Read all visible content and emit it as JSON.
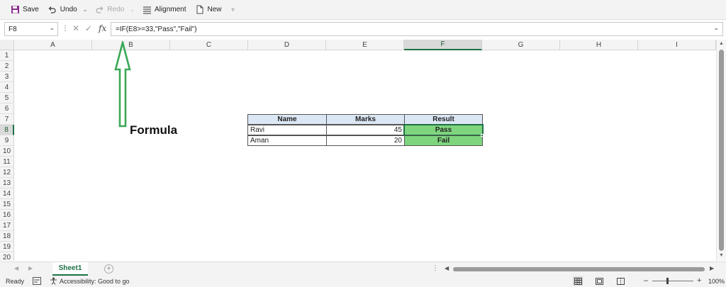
{
  "toolbar": {
    "save": "Save",
    "undo": "Undo",
    "redo": "Redo",
    "alignment": "Alignment",
    "new": "New"
  },
  "formula_bar": {
    "name_box": "F8",
    "formula": "=IF(E8>=33,\"Pass\",\"Fail\")"
  },
  "grid": {
    "columns": [
      "A",
      "B",
      "C",
      "D",
      "E",
      "F",
      "G",
      "H",
      "I"
    ],
    "rows": [
      "1",
      "2",
      "3",
      "4",
      "5",
      "6",
      "7",
      "8",
      "9",
      "10",
      "11",
      "12",
      "13",
      "14",
      "15",
      "16",
      "17",
      "18",
      "19",
      "20"
    ],
    "selected_column": "F",
    "selected_row": "8"
  },
  "table": {
    "headers": [
      "Name",
      "Marks",
      "Result"
    ],
    "rows": [
      {
        "name": "Ravi",
        "marks": "45",
        "result": "Pass"
      },
      {
        "name": "Aman",
        "marks": "20",
        "result": "Fail"
      }
    ]
  },
  "annotation": {
    "label": "Formula",
    "arrow_color": "#3aa856"
  },
  "sheets": {
    "active": "Sheet1"
  },
  "status": {
    "ready": "Ready",
    "accessibility": "Accessibility: Good to go",
    "zoom": "100%"
  },
  "colors": {
    "accent": "#1e7145",
    "header_fill": "#dbe7f4",
    "result_fill": "#7ed57e"
  }
}
